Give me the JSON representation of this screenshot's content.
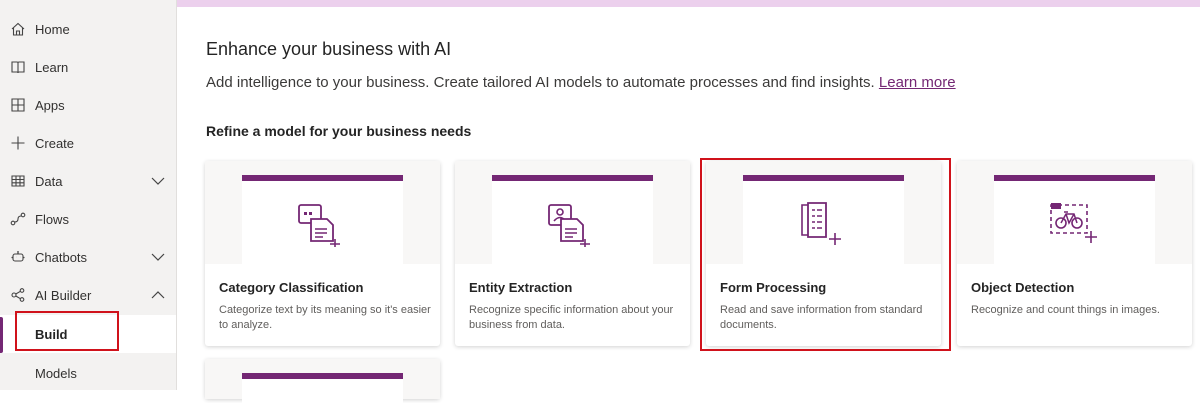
{
  "sidebar": {
    "items": [
      {
        "label": "Home",
        "icon": "home-icon"
      },
      {
        "label": "Learn",
        "icon": "book-icon"
      },
      {
        "label": "Apps",
        "icon": "apps-icon"
      },
      {
        "label": "Create",
        "icon": "plus-icon"
      },
      {
        "label": "Data",
        "icon": "table-icon",
        "expand": "collapsed"
      },
      {
        "label": "Flows",
        "icon": "flow-icon"
      },
      {
        "label": "Chatbots",
        "icon": "bot-icon",
        "expand": "collapsed"
      },
      {
        "label": "AI Builder",
        "icon": "ai-builder-icon",
        "expand": "expanded"
      }
    ],
    "sub_items": [
      {
        "label": "Build",
        "selected": true
      },
      {
        "label": "Models",
        "selected": false
      }
    ]
  },
  "main": {
    "title": "Enhance your business with AI",
    "subtitle": "Add intelligence to your business. Create tailored AI models to automate processes and find insights.",
    "learn_more": "Learn more",
    "section_title": "Refine a model for your business needs",
    "cards": [
      {
        "title": "Category Classification",
        "description": "Categorize text by its meaning so it's easier to analyze.",
        "icon": "category-classification-icon"
      },
      {
        "title": "Entity Extraction",
        "description": "Recognize specific information about your business from data.",
        "icon": "entity-extraction-icon"
      },
      {
        "title": "Form Processing",
        "description": "Read and save information from standard documents.",
        "icon": "form-processing-icon"
      },
      {
        "title": "Object Detection",
        "description": "Recognize and count things in images.",
        "icon": "object-detection-icon"
      }
    ]
  },
  "colors": {
    "accent": "#742774",
    "highlight": "#d0121b",
    "top_bar": "#ecd0ed",
    "sidebar_bg": "#f3f2f1"
  }
}
